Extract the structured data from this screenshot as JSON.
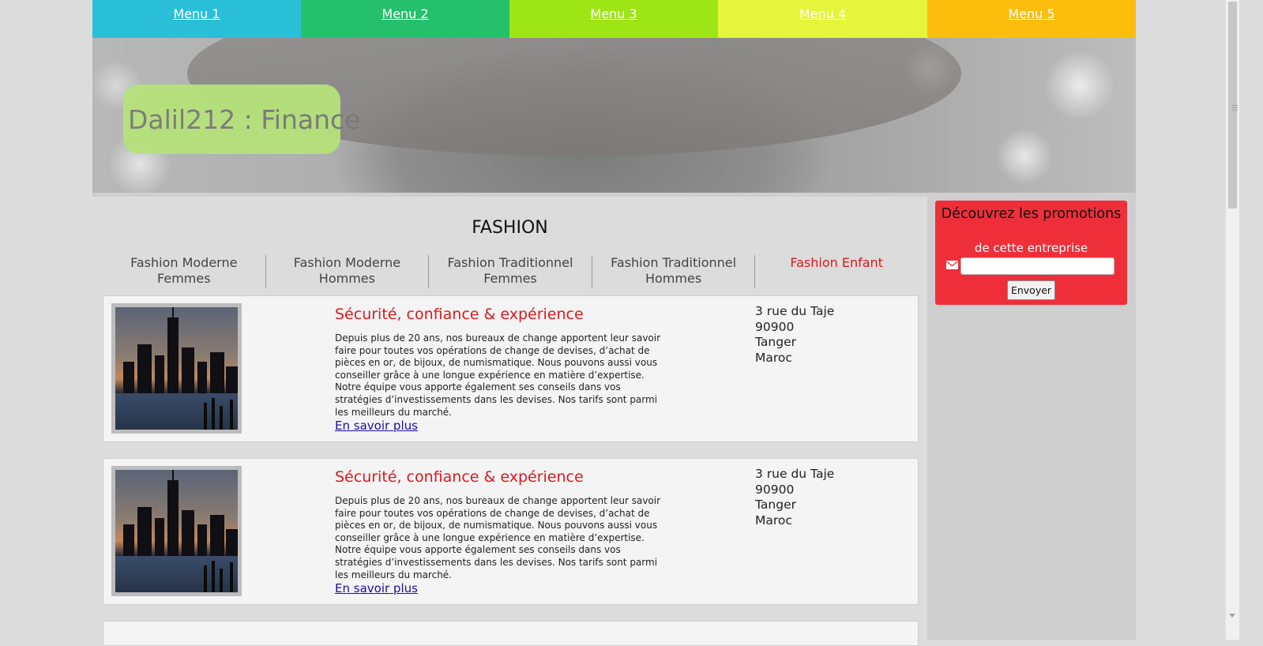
{
  "menu": {
    "items": [
      {
        "label": "Menu 1",
        "color": "#29bfd9"
      },
      {
        "label": "Menu 2",
        "color": "#24c06b"
      },
      {
        "label": "Menu 3",
        "color": "#9ee515"
      },
      {
        "label": "Menu 4",
        "color": "#e5f53c"
      },
      {
        "label": "Menu 5",
        "color": "#fcbd0c"
      }
    ]
  },
  "banner": {
    "title": "Dalil212 : Finance"
  },
  "section": {
    "title": "FASHION",
    "tabs": [
      {
        "label": "Fashion Moderne Femmes"
      },
      {
        "label": "Fashion Moderne Hommes"
      },
      {
        "label": "Fashion Traditionnel Femmes"
      },
      {
        "label": "Fashion Traditionnel Hommes"
      },
      {
        "label": "Fashion Enfant",
        "active": true
      }
    ]
  },
  "cards": [
    {
      "title": "Sécurité, confiance & expérience",
      "text": "Depuis plus de 20 ans, nos bureaux de change apportent leur savoir faire pour toutes vos opérations de change de devises, d’achat de pièces en or, de bijoux, de numismatique. Nous pouvons aussi vous conseiller grâce à une longue expérience en matière d’expertise. Notre équipe vous apporte également ses conseils dans vos stratégies d’investissements dans les devises. Nos tarifs sont parmi les meilleurs du marché.",
      "link": "En savoir plus",
      "address": [
        "3 rue du Taje",
        "90900",
        "Tanger",
        "Maroc"
      ]
    },
    {
      "title": "Sécurité, confiance & expérience",
      "text": "Depuis plus de 20 ans, nos bureaux de change apportent leur savoir faire pour toutes vos opérations de change de devises, d’achat de pièces en or, de bijoux, de numismatique. Nous pouvons aussi vous conseiller grâce à une longue expérience en matière d’expertise. Notre équipe vous apporte également ses conseils dans vos stratégies d’investissements dans les devises. Nos tarifs sont parmi les meilleurs du marché.",
      "link": "En savoir plus",
      "address": [
        "3 rue du Taje",
        "90900",
        "Tanger",
        "Maroc"
      ]
    }
  ],
  "promo": {
    "heading": "Découvrez les promotions",
    "subheading": "de cette entreprise",
    "input_value": "",
    "input_placeholder": "",
    "button_label": "Envoyer",
    "icon": "envelope-icon"
  },
  "colors": {
    "accent_red": "#e0171c",
    "promo_bg": "#ee2f3a",
    "title_box": "#b6e27a",
    "link": "#1a0dab"
  }
}
